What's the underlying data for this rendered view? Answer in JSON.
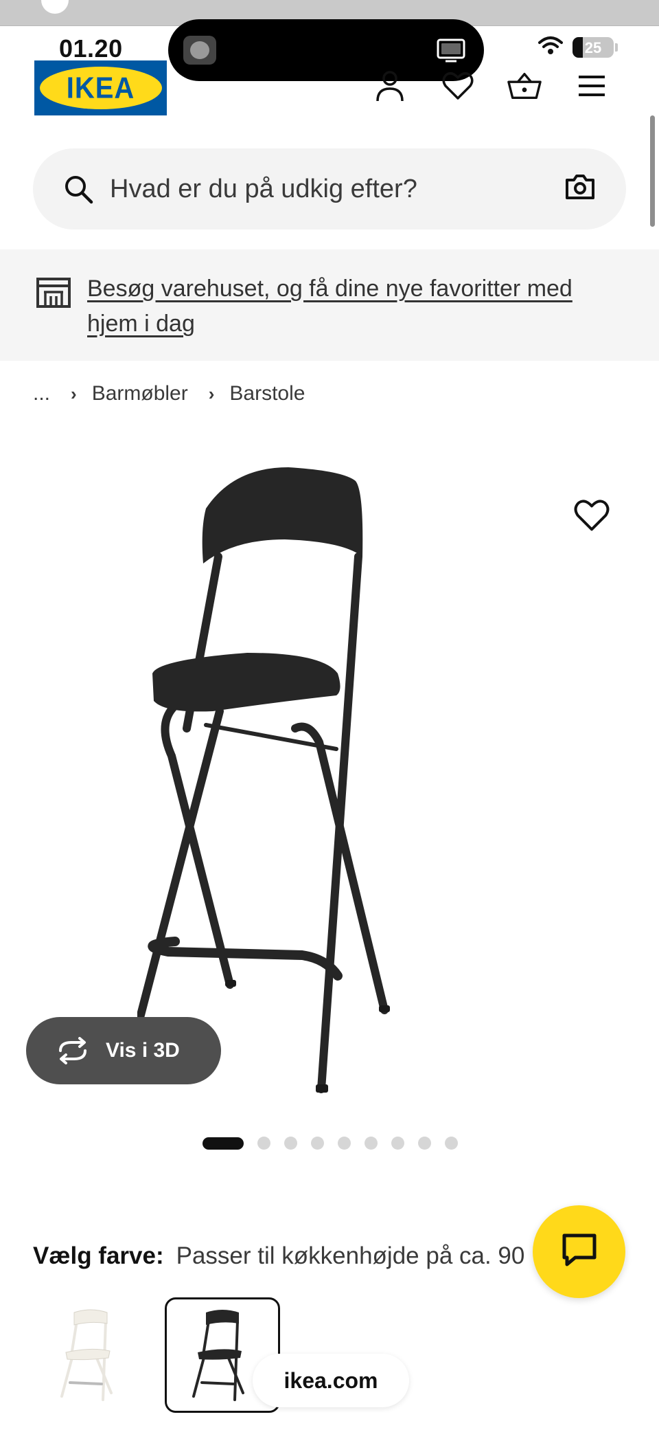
{
  "status_bar": {
    "time": "01.20",
    "battery": "25",
    "battery_fraction": 0.25
  },
  "brand": {
    "logo_text": "IKEA",
    "logo_blue": "#0058a3",
    "logo_yellow": "#ffda1a"
  },
  "header": {
    "icons": [
      "user-icon",
      "heart-icon",
      "basket-icon",
      "menu-icon"
    ]
  },
  "search": {
    "placeholder": "Hvad er du på udkig efter?",
    "icon": "search-icon",
    "camera_icon": "camera-icon"
  },
  "banner": {
    "icon": "store-icon",
    "link_text": "Besøg varehuset, og få dine nye favoritter med hjem i dag"
  },
  "breadcrumb": {
    "items": [
      "...",
      "Barmøbler",
      "Barstole"
    ]
  },
  "product_gallery": {
    "view_3d_label": "Vis i 3D",
    "image_count": 9,
    "active_index": 0
  },
  "variants": {
    "label": "Vælg farve:",
    "value": "Passer til køkkenhøjde på ca. 90",
    "options": [
      "white-bar-stool",
      "black-bar-stool"
    ],
    "selected_index": 1
  },
  "chat": {
    "icon": "chat-icon",
    "accent": "#ffd91a"
  },
  "browser": {
    "url": "ikea.com"
  }
}
